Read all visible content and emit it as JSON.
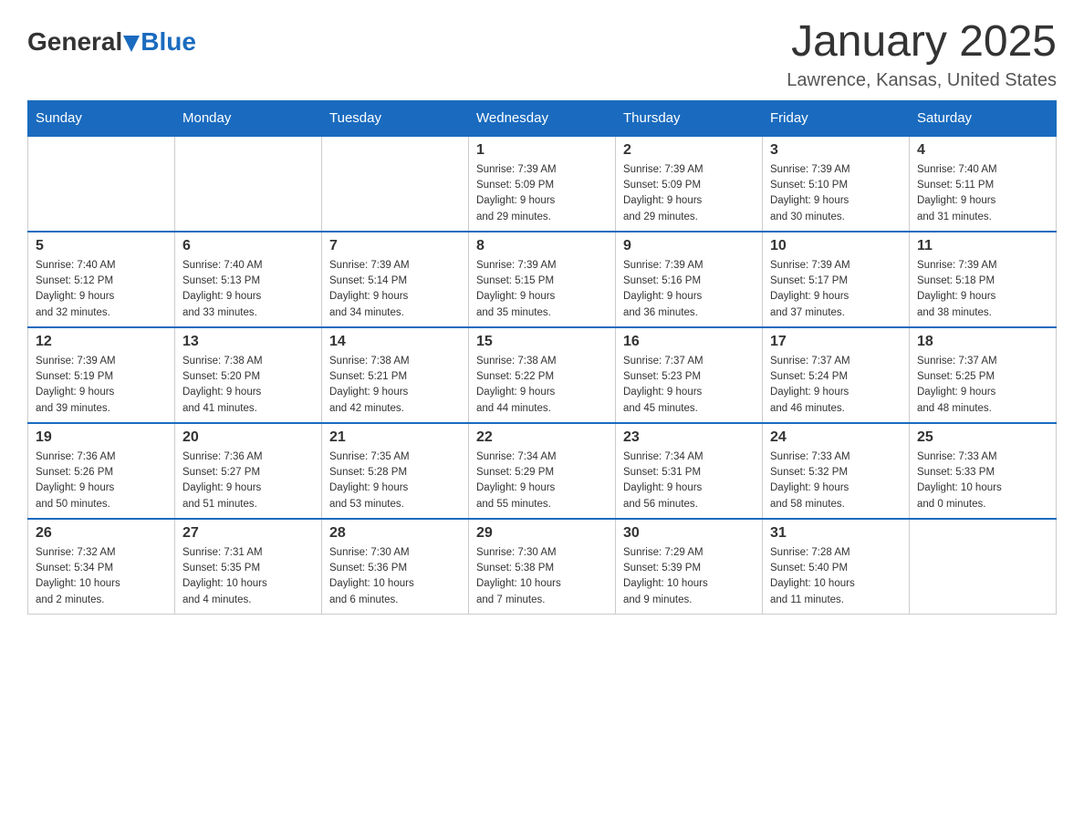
{
  "header": {
    "logo_general": "General",
    "logo_blue": "Blue",
    "month_title": "January 2025",
    "location": "Lawrence, Kansas, United States"
  },
  "days_of_week": [
    "Sunday",
    "Monday",
    "Tuesday",
    "Wednesday",
    "Thursday",
    "Friday",
    "Saturday"
  ],
  "weeks": [
    [
      {
        "day": "",
        "info": ""
      },
      {
        "day": "",
        "info": ""
      },
      {
        "day": "",
        "info": ""
      },
      {
        "day": "1",
        "info": "Sunrise: 7:39 AM\nSunset: 5:09 PM\nDaylight: 9 hours\nand 29 minutes."
      },
      {
        "day": "2",
        "info": "Sunrise: 7:39 AM\nSunset: 5:09 PM\nDaylight: 9 hours\nand 29 minutes."
      },
      {
        "day": "3",
        "info": "Sunrise: 7:39 AM\nSunset: 5:10 PM\nDaylight: 9 hours\nand 30 minutes."
      },
      {
        "day": "4",
        "info": "Sunrise: 7:40 AM\nSunset: 5:11 PM\nDaylight: 9 hours\nand 31 minutes."
      }
    ],
    [
      {
        "day": "5",
        "info": "Sunrise: 7:40 AM\nSunset: 5:12 PM\nDaylight: 9 hours\nand 32 minutes."
      },
      {
        "day": "6",
        "info": "Sunrise: 7:40 AM\nSunset: 5:13 PM\nDaylight: 9 hours\nand 33 minutes."
      },
      {
        "day": "7",
        "info": "Sunrise: 7:39 AM\nSunset: 5:14 PM\nDaylight: 9 hours\nand 34 minutes."
      },
      {
        "day": "8",
        "info": "Sunrise: 7:39 AM\nSunset: 5:15 PM\nDaylight: 9 hours\nand 35 minutes."
      },
      {
        "day": "9",
        "info": "Sunrise: 7:39 AM\nSunset: 5:16 PM\nDaylight: 9 hours\nand 36 minutes."
      },
      {
        "day": "10",
        "info": "Sunrise: 7:39 AM\nSunset: 5:17 PM\nDaylight: 9 hours\nand 37 minutes."
      },
      {
        "day": "11",
        "info": "Sunrise: 7:39 AM\nSunset: 5:18 PM\nDaylight: 9 hours\nand 38 minutes."
      }
    ],
    [
      {
        "day": "12",
        "info": "Sunrise: 7:39 AM\nSunset: 5:19 PM\nDaylight: 9 hours\nand 39 minutes."
      },
      {
        "day": "13",
        "info": "Sunrise: 7:38 AM\nSunset: 5:20 PM\nDaylight: 9 hours\nand 41 minutes."
      },
      {
        "day": "14",
        "info": "Sunrise: 7:38 AM\nSunset: 5:21 PM\nDaylight: 9 hours\nand 42 minutes."
      },
      {
        "day": "15",
        "info": "Sunrise: 7:38 AM\nSunset: 5:22 PM\nDaylight: 9 hours\nand 44 minutes."
      },
      {
        "day": "16",
        "info": "Sunrise: 7:37 AM\nSunset: 5:23 PM\nDaylight: 9 hours\nand 45 minutes."
      },
      {
        "day": "17",
        "info": "Sunrise: 7:37 AM\nSunset: 5:24 PM\nDaylight: 9 hours\nand 46 minutes."
      },
      {
        "day": "18",
        "info": "Sunrise: 7:37 AM\nSunset: 5:25 PM\nDaylight: 9 hours\nand 48 minutes."
      }
    ],
    [
      {
        "day": "19",
        "info": "Sunrise: 7:36 AM\nSunset: 5:26 PM\nDaylight: 9 hours\nand 50 minutes."
      },
      {
        "day": "20",
        "info": "Sunrise: 7:36 AM\nSunset: 5:27 PM\nDaylight: 9 hours\nand 51 minutes."
      },
      {
        "day": "21",
        "info": "Sunrise: 7:35 AM\nSunset: 5:28 PM\nDaylight: 9 hours\nand 53 minutes."
      },
      {
        "day": "22",
        "info": "Sunrise: 7:34 AM\nSunset: 5:29 PM\nDaylight: 9 hours\nand 55 minutes."
      },
      {
        "day": "23",
        "info": "Sunrise: 7:34 AM\nSunset: 5:31 PM\nDaylight: 9 hours\nand 56 minutes."
      },
      {
        "day": "24",
        "info": "Sunrise: 7:33 AM\nSunset: 5:32 PM\nDaylight: 9 hours\nand 58 minutes."
      },
      {
        "day": "25",
        "info": "Sunrise: 7:33 AM\nSunset: 5:33 PM\nDaylight: 10 hours\nand 0 minutes."
      }
    ],
    [
      {
        "day": "26",
        "info": "Sunrise: 7:32 AM\nSunset: 5:34 PM\nDaylight: 10 hours\nand 2 minutes."
      },
      {
        "day": "27",
        "info": "Sunrise: 7:31 AM\nSunset: 5:35 PM\nDaylight: 10 hours\nand 4 minutes."
      },
      {
        "day": "28",
        "info": "Sunrise: 7:30 AM\nSunset: 5:36 PM\nDaylight: 10 hours\nand 6 minutes."
      },
      {
        "day": "29",
        "info": "Sunrise: 7:30 AM\nSunset: 5:38 PM\nDaylight: 10 hours\nand 7 minutes."
      },
      {
        "day": "30",
        "info": "Sunrise: 7:29 AM\nSunset: 5:39 PM\nDaylight: 10 hours\nand 9 minutes."
      },
      {
        "day": "31",
        "info": "Sunrise: 7:28 AM\nSunset: 5:40 PM\nDaylight: 10 hours\nand 11 minutes."
      },
      {
        "day": "",
        "info": ""
      }
    ]
  ]
}
